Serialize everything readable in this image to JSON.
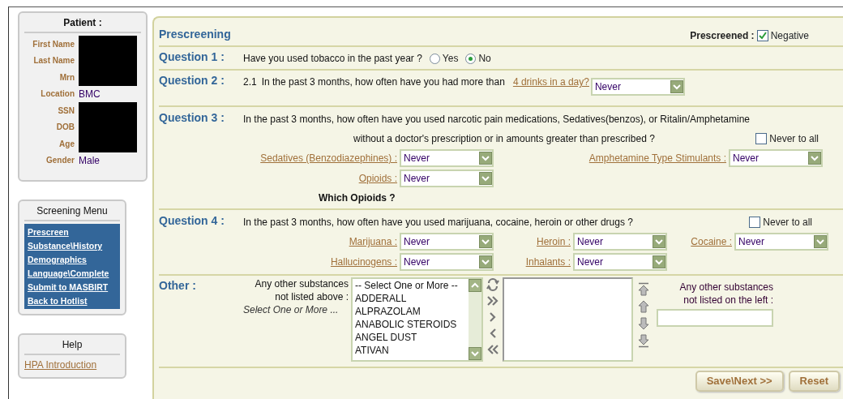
{
  "patient": {
    "title": "Patient :",
    "fields": [
      {
        "label": "First Name",
        "redacted": true
      },
      {
        "label": "Last Name",
        "redacted": true
      },
      {
        "label": "Mrn",
        "redacted": true
      },
      {
        "label": "Location",
        "value": "BMC",
        "redacted": false
      },
      {
        "label": "SSN",
        "redacted": true
      },
      {
        "label": "DOB",
        "redacted": true
      },
      {
        "label": "Age",
        "redacted": true
      },
      {
        "label": "Gender",
        "value": "Male",
        "redacted": false
      }
    ]
  },
  "screening_menu": {
    "title": "Screening Menu",
    "items": [
      "Prescreen",
      "Substance\\History",
      "Demographics",
      "Language\\Complete",
      "Submit to MASBIRT",
      "Back to Hotlist"
    ]
  },
  "help": {
    "title": "Help",
    "links": [
      "HPA Introduction"
    ]
  },
  "prescreening": {
    "title": "Prescreening",
    "prescreened_label": "Prescreened :",
    "negative": {
      "label": "Negative",
      "checked": true
    }
  },
  "questions": [
    {
      "label": "Question 1 :",
      "kind": "radio",
      "text": "Have you used tobacco in the past year ?",
      "options": [
        {
          "label": "Yes",
          "selected": false
        },
        {
          "label": "No",
          "selected": true
        }
      ]
    },
    {
      "label": "Question 2 :",
      "kind": "drinks",
      "number": "2.1",
      "text": "In the past 3 months, how often have you had more than",
      "link": "4 drinks in a day?",
      "value": "Never"
    },
    {
      "label": "Question 3 :",
      "kind": "substances",
      "lines": [
        "In the past 3 months, how often have you used narcotic pain medications, Sedatives(benzos), or Ritalin/Amphetamine",
        "without a doctor's prescription or in amounts greater than prescribed ?"
      ],
      "never_to_all": {
        "label": "Never to all",
        "checked": false
      },
      "rows": [
        [
          {
            "label": "Sedatives (Benzodiazephines) :",
            "value": "Never"
          },
          {
            "label": "Amphetamine Type Stimulants :",
            "value": "Never"
          }
        ],
        [
          {
            "label": "Opioids :",
            "value": "Never"
          }
        ]
      ],
      "note": "Which Opioids ?"
    },
    {
      "label": "Question 4 :",
      "kind": "substances",
      "lines": [
        "In the past 3 months, how often have you used marijuana, cocaine, heroin or other drugs ?"
      ],
      "never_to_all": {
        "label": "Never to all",
        "checked": false
      },
      "rows": [
        [
          {
            "label": "Marijuana :",
            "value": "Never"
          },
          {
            "label": "Heroin :",
            "value": "Never"
          },
          {
            "label": "Cocaine :",
            "value": "Never"
          }
        ],
        [
          {
            "label": "Hallucinogens :",
            "value": "Never"
          },
          {
            "label": "Inhalants :",
            "value": "Never"
          }
        ]
      ]
    }
  ],
  "other": {
    "label": "Other :",
    "prompt": [
      "Any other substances",
      "not listed above :"
    ],
    "hint": "Select One or More ...",
    "available": [
      "-- Select One or More --",
      "ADDERALL",
      "ALPRAZOLAM",
      "ANABOLIC STEROIDS",
      "ANGEL DUST",
      "ATIVAN"
    ],
    "free_text_label": [
      "Any other substances",
      "not listed on the left :"
    ]
  },
  "buttons": [
    "Save\\Next >>",
    "Reset"
  ]
}
